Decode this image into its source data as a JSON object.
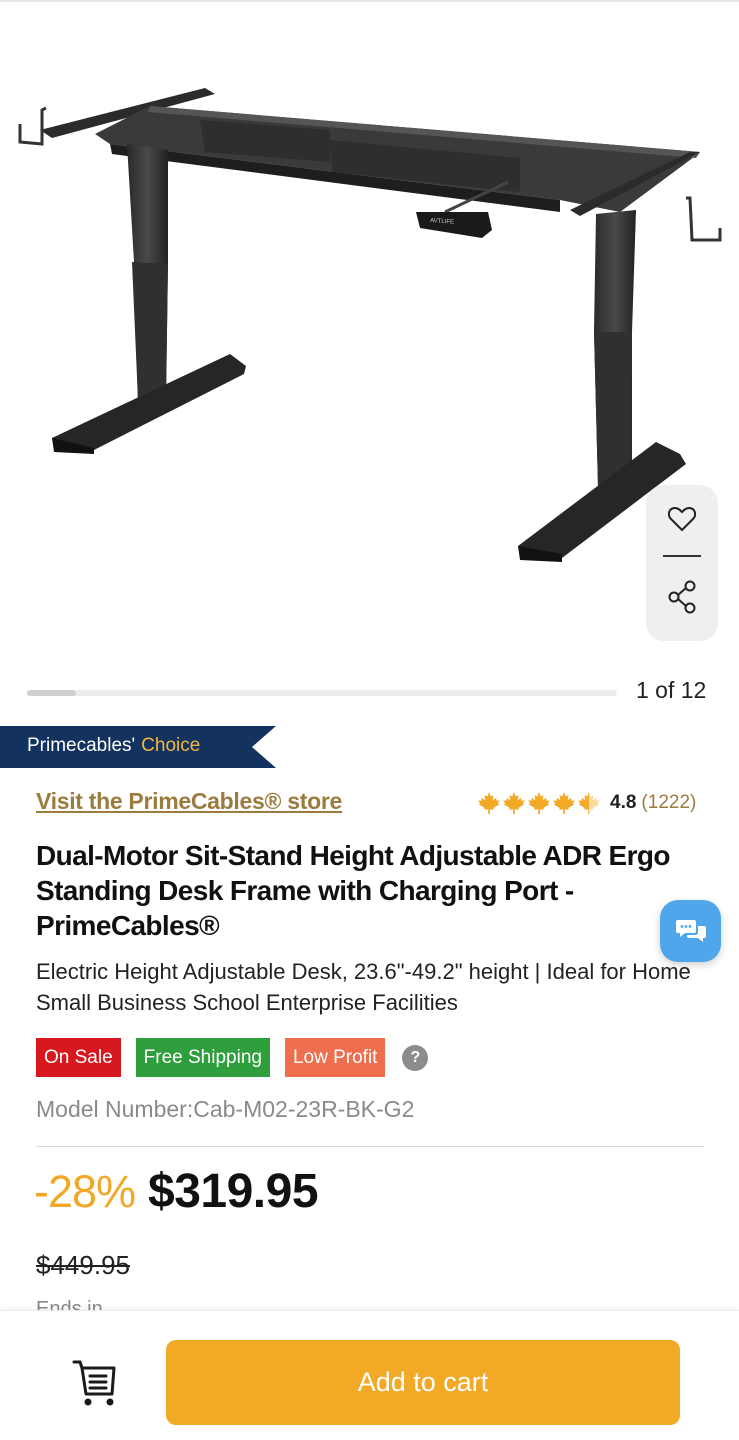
{
  "gallery": {
    "pager_text": "1 of 12",
    "current_index": 1,
    "total_images": 12,
    "image_subject": "standing desk frame",
    "controller_text": "AVTLIFE"
  },
  "actions": {
    "favorite_icon": "heart-icon",
    "share_icon": "share-icon"
  },
  "choice_banner": {
    "brand": "Primecables'",
    "accent": "Choice"
  },
  "store": {
    "link_text": "Visit the PrimeCables® store"
  },
  "rating": {
    "stars": 4.5,
    "score": "4.8",
    "count": "(1222)",
    "star_icon": "maple-leaf-icon"
  },
  "product": {
    "title": "Dual-Motor Sit-Stand Height Adjustable ADR Ergo Standing Desk Frame with Charging Port - PrimeCables®",
    "subtitle": "Electric Height Adjustable Desk, 23.6\"-49.2\" height | Ideal for Home Small Business School Enterprise Facilities",
    "model_number": "Model Number:Cab-M02-23R-BK-G2"
  },
  "badges": {
    "on_sale": "On Sale",
    "free_shipping": "Free Shipping",
    "low_profit": "Low Profit",
    "help": "?"
  },
  "pricing": {
    "discount": "-28%",
    "price": "$319.95",
    "original_price": "$449.95",
    "next_line_partial": "Ends in"
  },
  "bottom_bar": {
    "cart_icon": "cart-icon",
    "add_to_cart": "Add to cart"
  },
  "chat": {
    "icon": "chat-bubbles-icon"
  },
  "colors": {
    "accent_orange": "#f2a926",
    "store_gold": "#9b7c3e",
    "banner_navy": "#13325f",
    "sale_red": "#d7191f",
    "shipping_green": "#2f9e3c",
    "profit_orange": "#ef6e4e",
    "chat_blue": "#4fa6ea"
  }
}
